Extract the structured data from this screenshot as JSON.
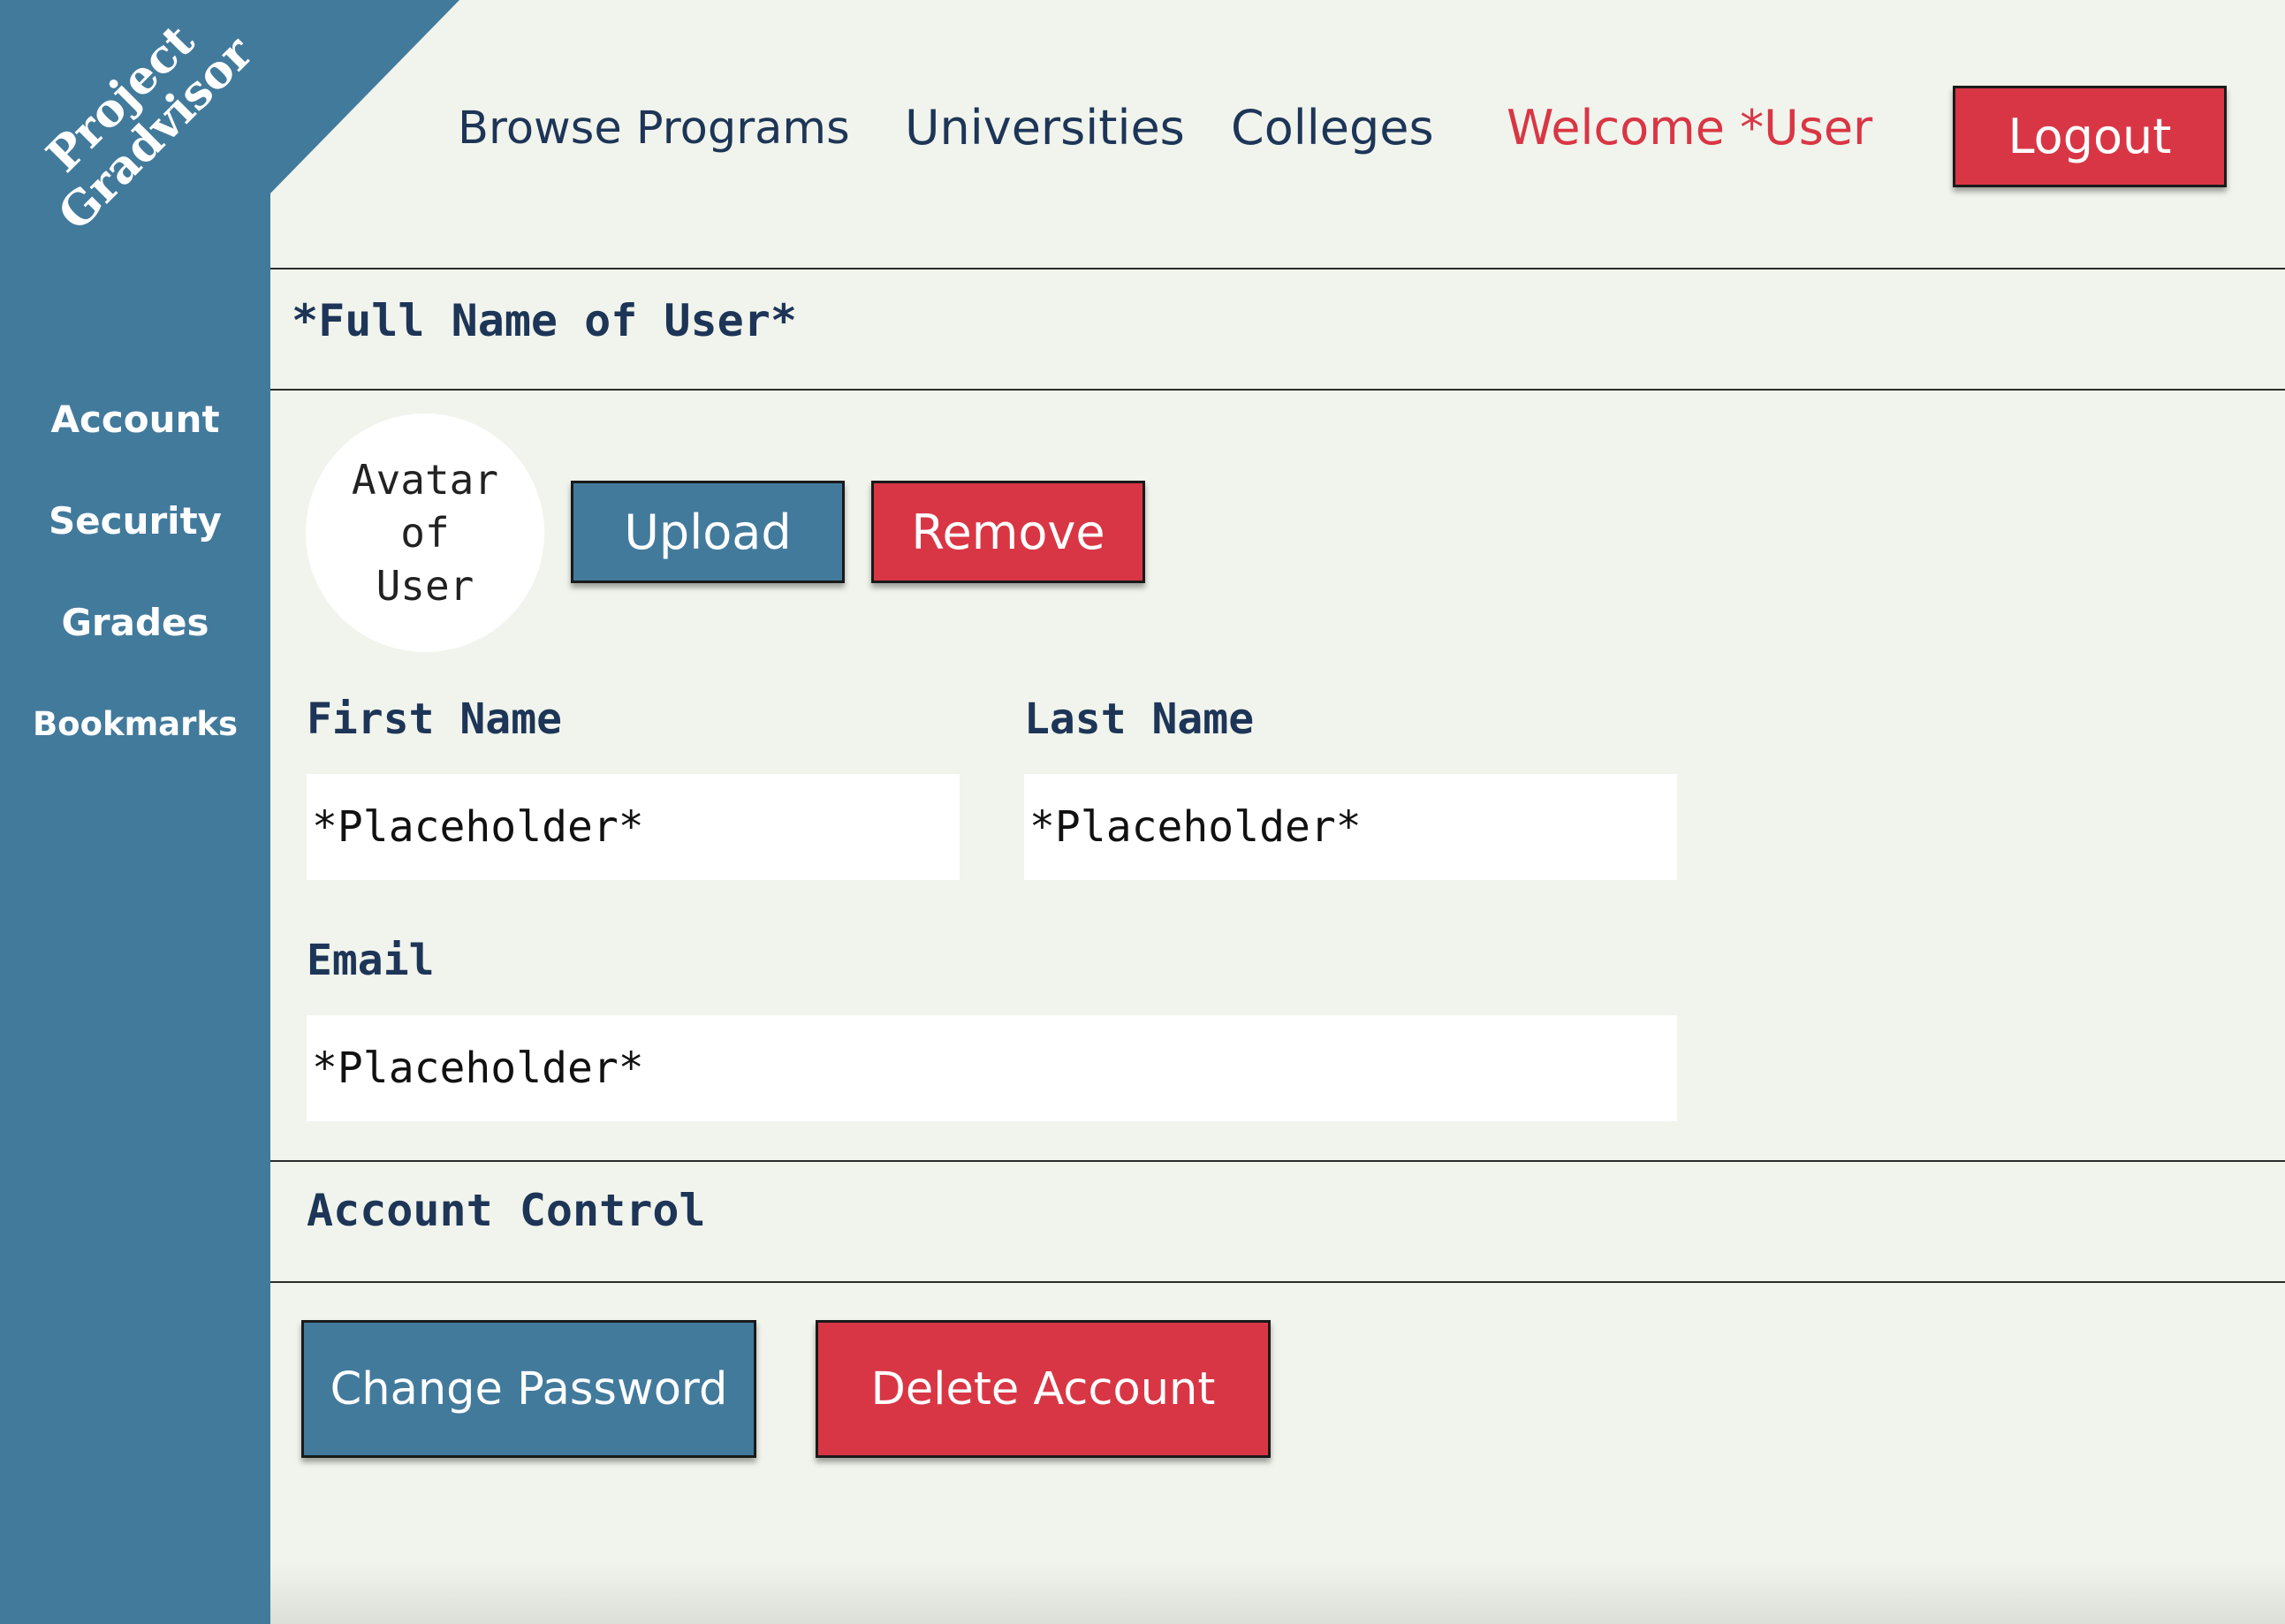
{
  "brand": {
    "line1": "Project",
    "line2": "Gradvisor"
  },
  "sidebar": {
    "items": [
      {
        "label": "Account"
      },
      {
        "label": "Security"
      },
      {
        "label": "Grades"
      },
      {
        "label": "Bookmarks"
      }
    ]
  },
  "topnav": {
    "links": [
      {
        "label": "Browse Programs"
      },
      {
        "label": "Universities"
      },
      {
        "label": "Colleges"
      }
    ],
    "welcome": "Welcome *User",
    "logout_label": "Logout"
  },
  "profile": {
    "full_name": "*Full Name of User*",
    "avatar_lines": [
      "Avatar",
      "of",
      "User"
    ],
    "upload_label": "Upload",
    "remove_label": "Remove"
  },
  "form": {
    "first_name_label": "First Name",
    "first_name_placeholder": "*Placeholder*",
    "last_name_label": "Last Name",
    "last_name_placeholder": "*Placeholder*",
    "email_label": "Email",
    "email_placeholder": "*Placeholder*"
  },
  "account_control": {
    "heading": "Account Control",
    "change_password_label": "Change Password",
    "delete_account_label": "Delete Account"
  },
  "colors": {
    "primary_blue": "#427a9c",
    "accent_red": "#d93645",
    "text_navy": "#1d3557",
    "background": "#f1f4ec"
  }
}
